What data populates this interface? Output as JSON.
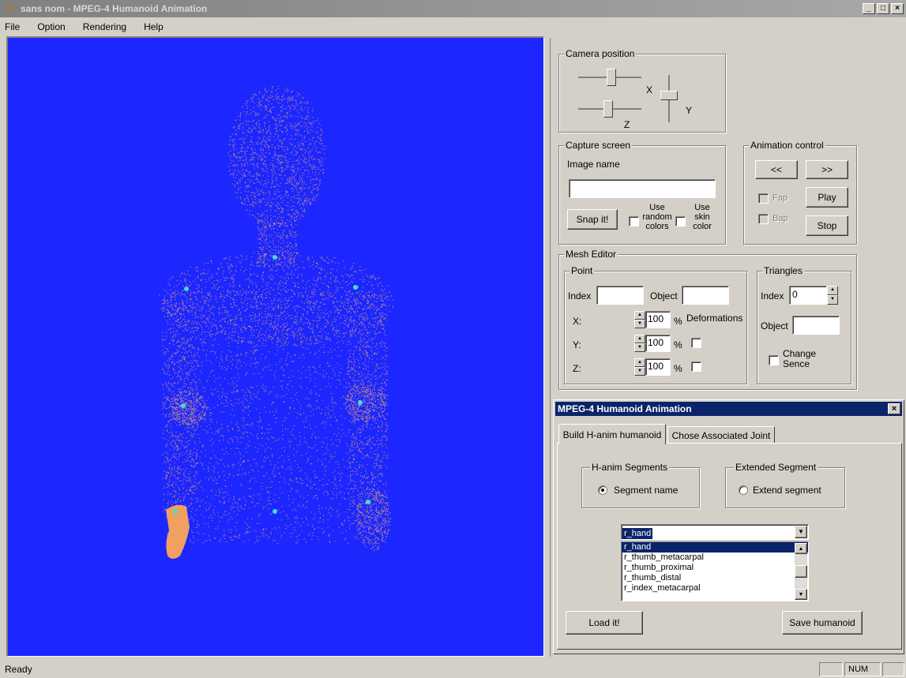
{
  "window": {
    "title": "sans nom - MPEG-4 Humanoid Animation",
    "minimize": "_",
    "maximize": "□",
    "close": "×"
  },
  "menu": [
    "File",
    "Option",
    "Rendering",
    "Help"
  ],
  "colors": {
    "viewport_bg": "#1c26ff",
    "point_cloud": "#e0a070",
    "joint": "#40e0d0",
    "hand_selected": "#f0a060",
    "dialog_title": "#0a246a"
  },
  "camera": {
    "label": "Camera position",
    "x_label": "X",
    "y_label": "Y",
    "z_label": "Z"
  },
  "capture": {
    "label": "Capture screen",
    "image_name_label": "Image name",
    "image_name_value": "",
    "snap_button": "Snap it!",
    "random_colors_label_1": "Use",
    "random_colors_label_2": "random",
    "random_colors_label_3": "colors",
    "skin_color_label_1": "Use",
    "skin_color_label_2": "skin",
    "skin_color_label_3": "color"
  },
  "animation": {
    "label": "Animation control",
    "prev_button": "<<",
    "next_button": ">>",
    "fap_label": "Fap",
    "bap_label": "Bap",
    "play_button": "Play",
    "stop_button": "Stop"
  },
  "mesh_editor": {
    "label": "Mesh Editor",
    "point": {
      "label": "Point",
      "index_label": "Index",
      "index_value": "",
      "object_label": "Object",
      "object_value": "",
      "x_label": "X:",
      "y_label": "Y:",
      "z_label": "Z:",
      "x_value": "100",
      "y_value": "100",
      "z_value": "100",
      "percent": "%",
      "deformations_label": "Deformations"
    },
    "triangles": {
      "label": "Triangles",
      "index_label": "Index",
      "index_value": "0",
      "object_label": "Object",
      "object_value": "",
      "change_sence_1": "Change",
      "change_sence_2": "Sence"
    }
  },
  "dialog": {
    "title": "MPEG-4 Humanoid Animation",
    "close": "×",
    "tabs": [
      "Build H-anim humanoid",
      "Chose Associated Joint"
    ],
    "hanim_segments_label": "H-anim Segments",
    "segment_name_label": "Segment name",
    "extended_segment_label": "Extended Segment",
    "extend_segment_label": "Extend segment",
    "combo_value": "r_hand",
    "list": [
      "r_hand",
      "r_thumb_metacarpal",
      "r_thumb_proximal",
      "r_thumb_distal",
      "r_index_metacarpal"
    ],
    "list_selected": 0,
    "load_button": "Load it!",
    "save_button": "Save humanoid"
  },
  "status": {
    "text": "Ready",
    "num": "NUM"
  }
}
